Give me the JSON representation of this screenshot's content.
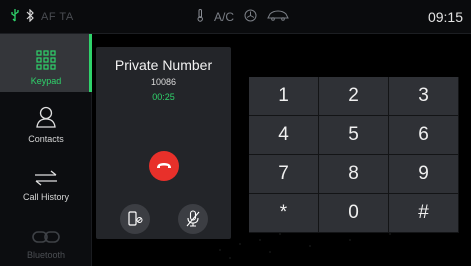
{
  "statusbar": {
    "af_ta": "AF TA",
    "ac": "A/C",
    "time": "09:15",
    "icons": [
      "usb-icon",
      "bluetooth-icon",
      "thermometer-icon",
      "fan-icon",
      "car-icon"
    ]
  },
  "sidebar": {
    "items": [
      {
        "label": "Keypad",
        "icon": "keypad-icon",
        "active": true
      },
      {
        "label": "Contacts",
        "icon": "contact-person-icon",
        "active": false
      },
      {
        "label": "Call History",
        "icon": "call-history-arrows-icon",
        "active": false
      },
      {
        "label": "Bluetooth",
        "icon": "bluetooth-link-icon",
        "active": false,
        "disabled": true
      }
    ]
  },
  "call": {
    "name": "Private Number",
    "number": "10086",
    "duration": "00:25",
    "hangup_icon": "hang-up-icon",
    "handset_icon": "phone-privacy-icon",
    "mute_icon": "mic-mute-icon"
  },
  "keypad": {
    "keys": [
      "1",
      "2",
      "3",
      "4",
      "5",
      "6",
      "7",
      "8",
      "9",
      "*",
      "0",
      "#"
    ]
  },
  "colors": {
    "accent": "#2fd36b",
    "hangup": "#e8302a",
    "key_bg": "#2f3136",
    "panel_bg": "#232529"
  }
}
